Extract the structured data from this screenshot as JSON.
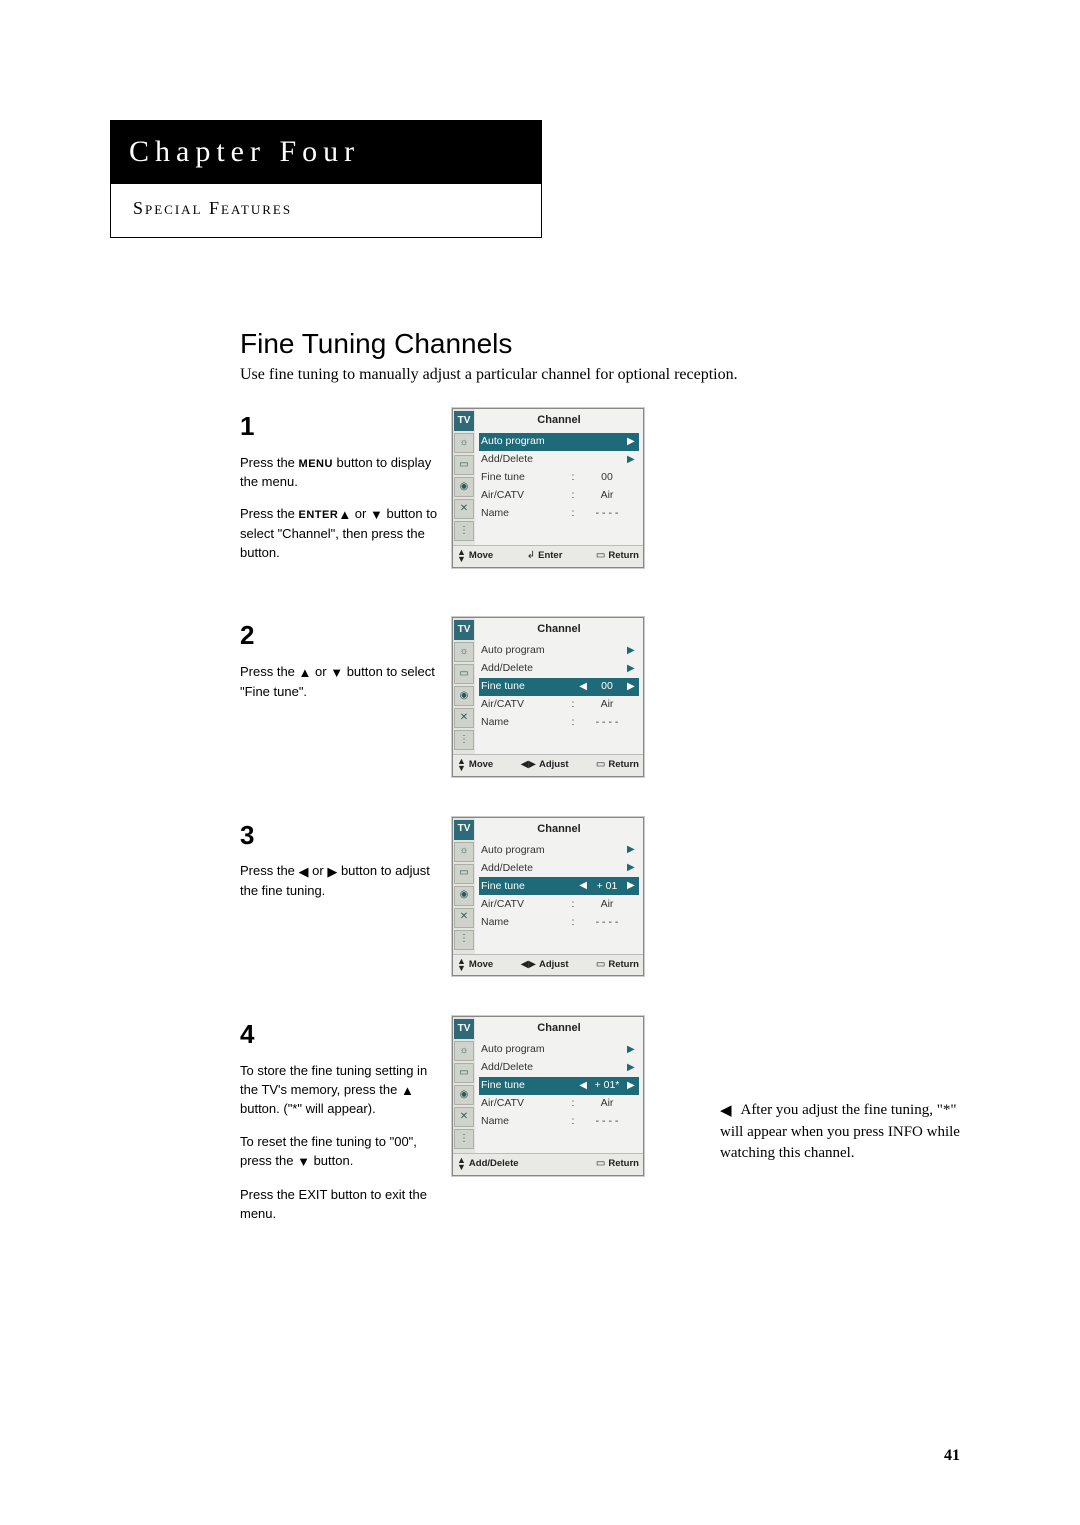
{
  "chapter": {
    "title": "Chapter Four",
    "subtitle": "Special Features"
  },
  "section": {
    "title": "Fine Tuning Channels",
    "desc": "Use fine tuning to manually adjust a particular channel for optional reception."
  },
  "glyph": {
    "up": "▲",
    "down": "▼",
    "left": "◀",
    "right": "▶",
    "lr": "◀▶",
    "ud": "▲\n▼",
    "menu": "▭",
    "back": "◀"
  },
  "steps": [
    {
      "num": "1",
      "paras": [
        {
          "plain_a": "Press the ",
          "bold": "MENU",
          "plain_b": " button to display the menu."
        },
        {
          "plain_a": "Press the ",
          "glyph_a": "up",
          "mid": " or ",
          "glyph_b": "down",
          "plain_b": " button to select \"Channel\", then press the ",
          "bold": "ENTER",
          "tail": " button."
        }
      ],
      "menu": {
        "title": "Channel",
        "rows": [
          {
            "lbl": "Auto program",
            "col": "",
            "val": "",
            "arr": "▶",
            "sel": true,
            "la": ""
          },
          {
            "lbl": "Add/Delete",
            "col": "",
            "val": "",
            "arr": "▶",
            "sel": false,
            "la": ""
          },
          {
            "lbl": "Fine tune",
            "col": ":",
            "val": "00",
            "arr": "",
            "sel": false,
            "la": ""
          },
          {
            "lbl": "Air/CATV",
            "col": ":",
            "val": "Air",
            "arr": "",
            "sel": false,
            "la": ""
          },
          {
            "lbl": "Name",
            "col": ":",
            "val": "- - - -",
            "arr": "",
            "sel": false,
            "la": ""
          }
        ],
        "footer": [
          {
            "icon": "ud",
            "txt": "Move"
          },
          {
            "icon": "enter",
            "txt": "Enter"
          },
          {
            "icon": "menu",
            "txt": "Return"
          }
        ]
      }
    },
    {
      "num": "2",
      "paras": [
        {
          "plain_a": "Press the ",
          "glyph_a": "up",
          "mid": " or ",
          "glyph_b": "down",
          "plain_b": " button to select \"Fine tune\"."
        }
      ],
      "menu": {
        "title": "Channel",
        "rows": [
          {
            "lbl": "Auto program",
            "col": "",
            "val": "",
            "arr": "▶",
            "sel": false,
            "la": ""
          },
          {
            "lbl": "Add/Delete",
            "col": "",
            "val": "",
            "arr": "▶",
            "sel": false,
            "la": ""
          },
          {
            "lbl": "Fine tune",
            "col": "",
            "val": "00",
            "arr": "▶",
            "sel": true,
            "la": "◀"
          },
          {
            "lbl": "Air/CATV",
            "col": ":",
            "val": "Air",
            "arr": "",
            "sel": false,
            "la": ""
          },
          {
            "lbl": "Name",
            "col": ":",
            "val": "- - - -",
            "arr": "",
            "sel": false,
            "la": ""
          }
        ],
        "footer": [
          {
            "icon": "ud",
            "txt": "Move"
          },
          {
            "icon": "lr",
            "txt": "Adjust"
          },
          {
            "icon": "menu",
            "txt": "Return"
          }
        ]
      }
    },
    {
      "num": "3",
      "paras": [
        {
          "plain_a": "Press the ",
          "glyph_a": "left",
          "mid": " or ",
          "glyph_b": "right",
          "plain_b": " button to adjust the fine tuning."
        }
      ],
      "menu": {
        "title": "Channel",
        "rows": [
          {
            "lbl": "Auto program",
            "col": "",
            "val": "",
            "arr": "▶",
            "sel": false,
            "la": ""
          },
          {
            "lbl": "Add/Delete",
            "col": "",
            "val": "",
            "arr": "▶",
            "sel": false,
            "la": ""
          },
          {
            "lbl": "Fine tune",
            "col": "",
            "val": "+ 01",
            "arr": "▶",
            "sel": true,
            "la": "◀"
          },
          {
            "lbl": "Air/CATV",
            "col": ":",
            "val": "Air",
            "arr": "",
            "sel": false,
            "la": ""
          },
          {
            "lbl": "Name",
            "col": ":",
            "val": "- - - -",
            "arr": "",
            "sel": false,
            "la": ""
          }
        ],
        "footer": [
          {
            "icon": "ud",
            "txt": "Move"
          },
          {
            "icon": "lr",
            "txt": "Adjust"
          },
          {
            "icon": "menu",
            "txt": "Return"
          }
        ]
      }
    },
    {
      "num": "4",
      "paras": [
        {
          "plain_a": "To store the fine tuning setting in the TV's memory, press the ",
          "glyph_a": "up",
          "plain_b": " button. (\"*\" will appear)."
        },
        {
          "plain_a": "To reset the fine tuning to \"00\", press the ",
          "glyph_a": "down",
          "plain_b": " button."
        },
        {
          "plain_a": "Press the EXIT button to exit the menu."
        }
      ],
      "menu": {
        "title": "Channel",
        "rows": [
          {
            "lbl": "Auto program",
            "col": "",
            "val": "",
            "arr": "▶",
            "sel": false,
            "la": ""
          },
          {
            "lbl": "Add/Delete",
            "col": "",
            "val": "",
            "arr": "▶",
            "sel": false,
            "la": ""
          },
          {
            "lbl": "Fine tune",
            "col": "",
            "val": "+ 01*",
            "arr": "▶",
            "sel": true,
            "la": "◀"
          },
          {
            "lbl": "Air/CATV",
            "col": ":",
            "val": "Air",
            "arr": "",
            "sel": false,
            "la": ""
          },
          {
            "lbl": "Name",
            "col": ":",
            "val": "- - - -",
            "arr": "",
            "sel": false,
            "la": ""
          }
        ],
        "footer": [
          {
            "icon": "ud",
            "txt": "Add/Delete"
          },
          {
            "icon": "",
            "txt": ""
          },
          {
            "icon": "menu",
            "txt": "Return"
          }
        ]
      }
    }
  ],
  "sidebar_icons": [
    "TV",
    "☼",
    "▭",
    "◉",
    "✕",
    "⋮"
  ],
  "sidenote": "After you adjust the fine tuning, \"*\" will appear when you press INFO while watching this channel.",
  "page_number": "41"
}
